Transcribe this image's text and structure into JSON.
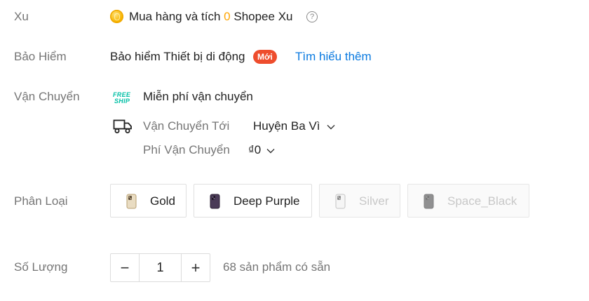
{
  "xu": {
    "label": "Xu",
    "prefix": "Mua hàng và tích",
    "count": "0",
    "suffix": "Shopee Xu",
    "help_glyph": "?"
  },
  "insurance": {
    "label": "Bảo Hiểm",
    "text": "Bảo hiểm Thiết bị di động",
    "badge": "Mới",
    "link": "Tìm hiểu thêm"
  },
  "shipping": {
    "label": "Vận Chuyển",
    "freeship_logo": [
      "FREE",
      "SHIP"
    ],
    "free_text": "Miễn phí vận chuyển",
    "to_label": "Vận Chuyển Tới",
    "to_value": "Huyện Ba Vì",
    "fee_label": "Phí Vận Chuyển",
    "fee_value": "₫0"
  },
  "variants": {
    "label": "Phân Loại",
    "options": [
      {
        "label": "Gold",
        "disabled": false,
        "color": "#d9b882"
      },
      {
        "label": "Deep Purple",
        "disabled": false,
        "color": "#4a3a57"
      },
      {
        "label": "Silver",
        "disabled": true,
        "color": "#d9d9d9"
      },
      {
        "label": "Space_Black",
        "disabled": true,
        "color": "#3a3a3c"
      }
    ]
  },
  "quantity": {
    "label": "Số Lượng",
    "decrement": "−",
    "value": "1",
    "increment": "+",
    "stock": "68 sản phẩm có sẵn"
  },
  "colors": {
    "accent": "#ee4d2d",
    "link": "#0a7ae0",
    "coin": "#ffa502",
    "freeship": "#00bfa5"
  }
}
